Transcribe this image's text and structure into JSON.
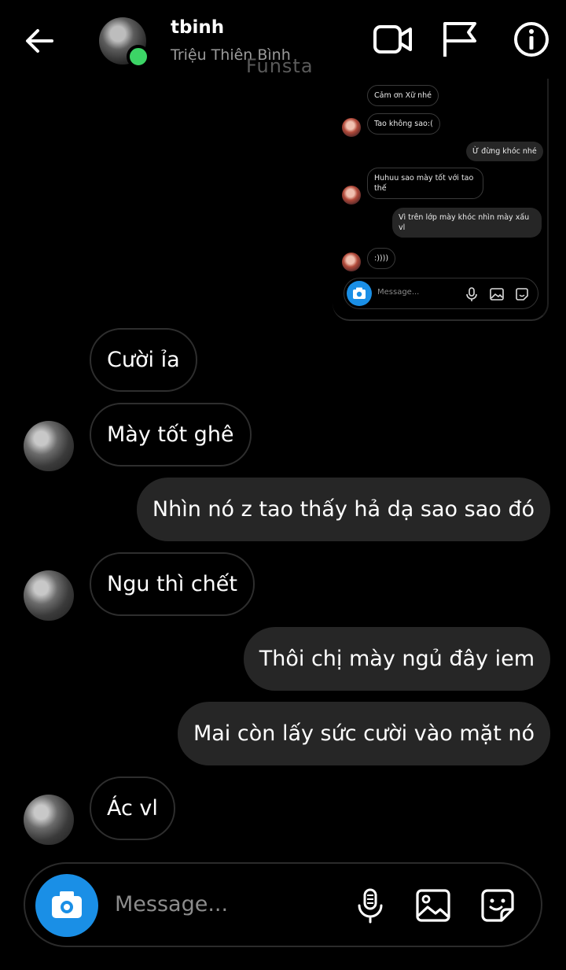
{
  "header": {
    "name": "tbinh",
    "subtitle": "Triệu Thiên Bình",
    "watermark": "Funsta"
  },
  "screenshot": {
    "messages": [
      {
        "text": "Cảm ơn Xữ nhé",
        "side": "in"
      },
      {
        "text": "Tao không sao:(",
        "side": "in"
      },
      {
        "text": "Ừ đừng khóc nhé",
        "side": "out"
      },
      {
        "text": "Huhuu sao mày tốt với tao thế",
        "side": "in"
      },
      {
        "text": "Vì trên lớp mày khóc nhìn mày xấu vl",
        "side": "out"
      },
      {
        "text": ":))))",
        "side": "in"
      }
    ],
    "placeholder": "Message..."
  },
  "messages": [
    {
      "text": "Cười ỉa",
      "side": "in"
    },
    {
      "text": "Mày tốt ghê",
      "side": "in"
    },
    {
      "text": "Nhìn nó z tao thấy hả dạ sao sao đó",
      "side": "out"
    },
    {
      "text": "Ngu thì chết",
      "side": "in"
    },
    {
      "text": "Thôi chị mày ngủ đây iem",
      "side": "out"
    },
    {
      "text": "Mai còn lấy sức cười vào mặt nó",
      "side": "out"
    },
    {
      "text": "Ác vl",
      "side": "in"
    }
  ],
  "composer": {
    "placeholder": "Message..."
  },
  "icons": {
    "back": "arrow-left-icon",
    "video": "video-camera-icon",
    "flag": "flag-icon",
    "info": "info-icon",
    "camera": "camera-icon",
    "mic": "microphone-icon",
    "gallery": "image-icon",
    "sticker": "sticker-icon"
  },
  "colors": {
    "background": "#000000",
    "outgoing_bubble": "#262626",
    "accent": "#1a8fe6",
    "online": "#3cd466"
  }
}
